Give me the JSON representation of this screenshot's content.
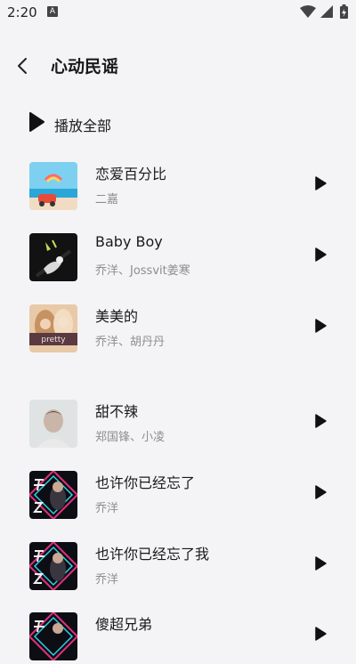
{
  "status_bar": {
    "time": "2:20",
    "notification_icon": "A"
  },
  "header": {
    "title": "心动民谣",
    "back_icon": "chevron-left-icon"
  },
  "play_all": {
    "label": "播放全部",
    "icon": "play-icon"
  },
  "songs": [
    {
      "title": "恋爱百分比",
      "artist": "二嘉",
      "cover": "beach-cover"
    },
    {
      "title": "Baby Boy",
      "artist": "乔洋、Jossvit姜寒",
      "cover": "dark-figure-cover"
    },
    {
      "title": "美美的",
      "artist": "乔洋、胡丹丹",
      "cover": "pretty-cover",
      "cover_text": "pretty"
    },
    {
      "title": "甜不辣",
      "artist": "郑国锋、小凌",
      "cover": "portrait-cover"
    },
    {
      "title": "也许你已经忘了",
      "artist": "乔洋",
      "cover": "neon-cover"
    },
    {
      "title": "也许你已经忘了我",
      "artist": "乔洋",
      "cover": "neon-cover"
    },
    {
      "title": "傻超兄弟",
      "artist": "",
      "cover": "neon-cover"
    }
  ],
  "colors": {
    "background": "#f4f4f6",
    "text": "#1a1a1a",
    "secondary_text": "#8d8d8d"
  }
}
